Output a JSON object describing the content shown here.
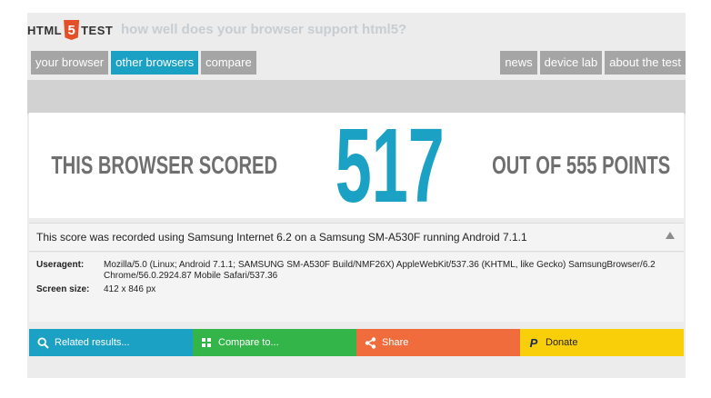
{
  "logo": {
    "left": "HTML",
    "badge": "5",
    "right": "TEST"
  },
  "tagline": "how well does your browser support html5?",
  "nav_left": [
    {
      "label": "your browser",
      "active": false
    },
    {
      "label": "other browsers",
      "active": true
    },
    {
      "label": "compare",
      "active": false
    }
  ],
  "nav_right": [
    {
      "label": "news"
    },
    {
      "label": "device lab"
    },
    {
      "label": "about the test"
    }
  ],
  "score": {
    "prefix": "THIS BROWSER SCORED",
    "value": "517",
    "suffix": "OUT OF 555 POINTS"
  },
  "recorded": "This score was recorded using Samsung Internet 6.2 on a Samsung SM-A530F running Android 7.1.1",
  "details": {
    "useragent_label": "Useragent:",
    "useragent_value": "Mozilla/5.0 (Linux; Android 7.1.1; SAMSUNG SM-A530F Build/NMF26X) AppleWebKit/537.36 (KHTML, like Gecko) SamsungBrowser/6.2 Chrome/56.0.2924.87 Mobile Safari/537.36",
    "screen_label": "Screen size:",
    "screen_value": "412 x 846 px"
  },
  "actions": {
    "related": "Related results...",
    "compare": "Compare to...",
    "share": "Share",
    "donate": "Donate"
  },
  "colors": {
    "accent": "#1aa1c4",
    "compare": "#33b54a",
    "share": "#f16c3c",
    "donate": "#f9cf0a"
  }
}
